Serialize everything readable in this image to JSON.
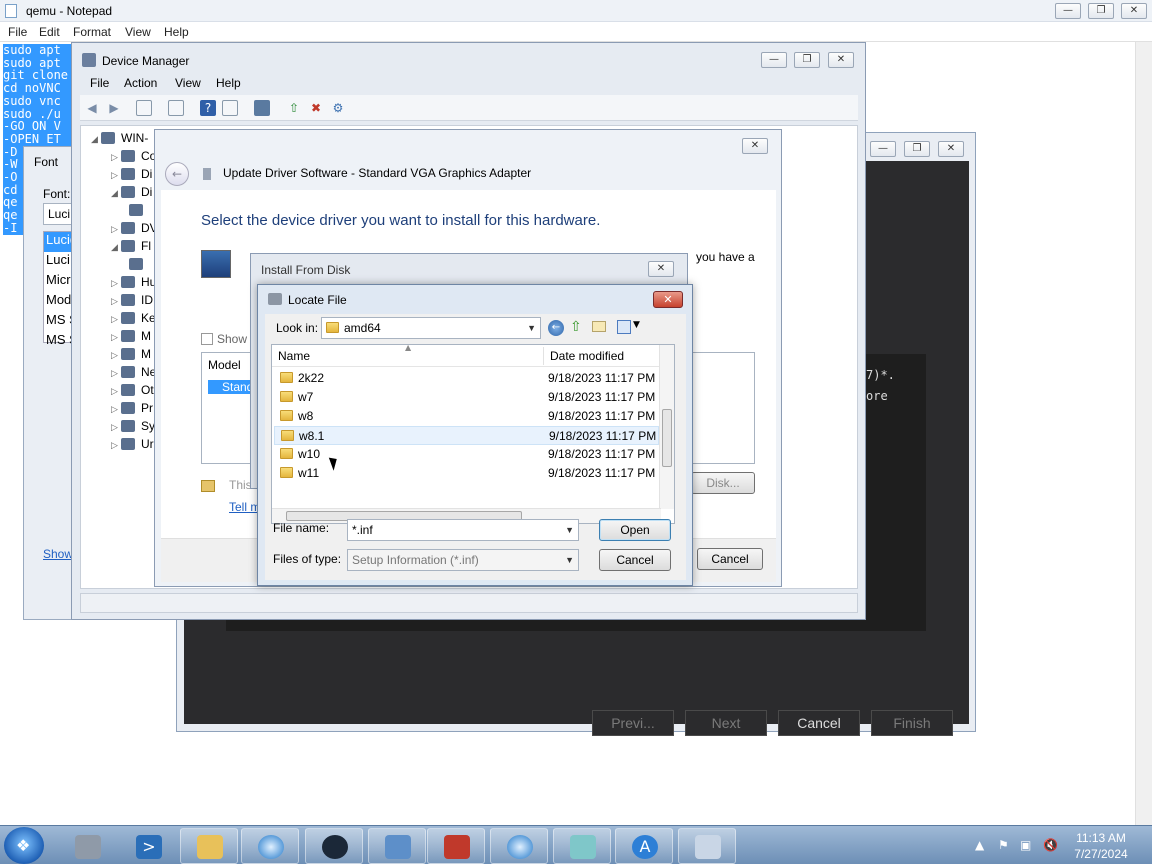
{
  "notepad": {
    "title": "qemu - Notepad",
    "menu": [
      "File",
      "Edit",
      "Format",
      "View",
      "Help"
    ],
    "lines": [
      "sudo apt",
      "sudo apt",
      "git clone",
      "cd noVNC",
      "sudo vnc",
      "sudo ./u",
      "-GO ON V",
      "-OPEN ET",
      "-D",
      "-W",
      "-O",
      "cd",
      "qe",
      "qe",
      "-I"
    ]
  },
  "font_dialog": {
    "title": "Font",
    "font_label": "Font:",
    "font_value": "Luci",
    "font_list": [
      "Lucida",
      "Luci",
      "Micr",
      "Mode",
      "MS S",
      "MS S"
    ],
    "show_link": "Show"
  },
  "device_manager": {
    "title": "Device Manager",
    "menu": [
      "File",
      "Action",
      "View",
      "Help"
    ],
    "root": "WIN-",
    "tree": [
      "Co",
      "Di",
      "Di",
      "",
      "DV",
      "Fl",
      "",
      "Hu",
      "ID",
      "Ke",
      "M",
      "M",
      "Ne",
      "Ot",
      "Pr",
      "Sy",
      "Ur"
    ]
  },
  "update_driver": {
    "title": "Update Driver Software - Standard VGA Graphics Adapter",
    "heading": "Select the device driver you want to install for this hardware.",
    "trailing_text": "you have a",
    "show_compat": "Show",
    "model_header": "Model",
    "model_item": "Stand",
    "signed_text": "This",
    "tell_link": "Tell m",
    "have_disk": "Disk...",
    "cancel": "Cancel"
  },
  "install_from_disk": {
    "title": "Install From Disk"
  },
  "locate_file": {
    "title": "Locate File",
    "look_in_label": "Look in:",
    "look_in_value": "amd64",
    "col_name": "Name",
    "col_date": "Date modified",
    "files": [
      {
        "name": "2k22",
        "date": "9/18/2023 11:17 PM"
      },
      {
        "name": "w7",
        "date": "9/18/2023 11:17 PM"
      },
      {
        "name": "w8",
        "date": "9/18/2023 11:17 PM"
      },
      {
        "name": "w8.1",
        "date": "9/18/2023 11:17 PM"
      },
      {
        "name": "w10",
        "date": "9/18/2023 11:17 PM"
      },
      {
        "name": "w11",
        "date": "9/18/2023 11:17 PM"
      }
    ],
    "file_name_label": "File name:",
    "file_name_value": "*.inf",
    "file_type_label": "Files of type:",
    "file_type_value": "Setup Information (*.inf)",
    "open": "Open",
    "cancel": "Cancel"
  },
  "wizard_bg": {
    "terminal_line1": "7)*.",
    "terminal_line2": "ore",
    "prev": "Previ...",
    "next": "Next",
    "cancel": "Cancel",
    "finish": "Finish"
  },
  "taskbar": {
    "time": "11:13 AM",
    "date": "7/27/2024",
    "apps": [
      "server-manager-icon",
      "powershell-icon",
      "explorer-icon",
      "browser-icon",
      "steam-icon",
      "control-panel-icon",
      "toolbox-icon",
      "browser2-icon",
      "tablet-icon",
      "app-store-icon",
      "recycle-icon"
    ]
  },
  "colors": {
    "selection": "#3399ff",
    "heading_blue": "#1e3f7a",
    "close_red": "#c6422e"
  }
}
